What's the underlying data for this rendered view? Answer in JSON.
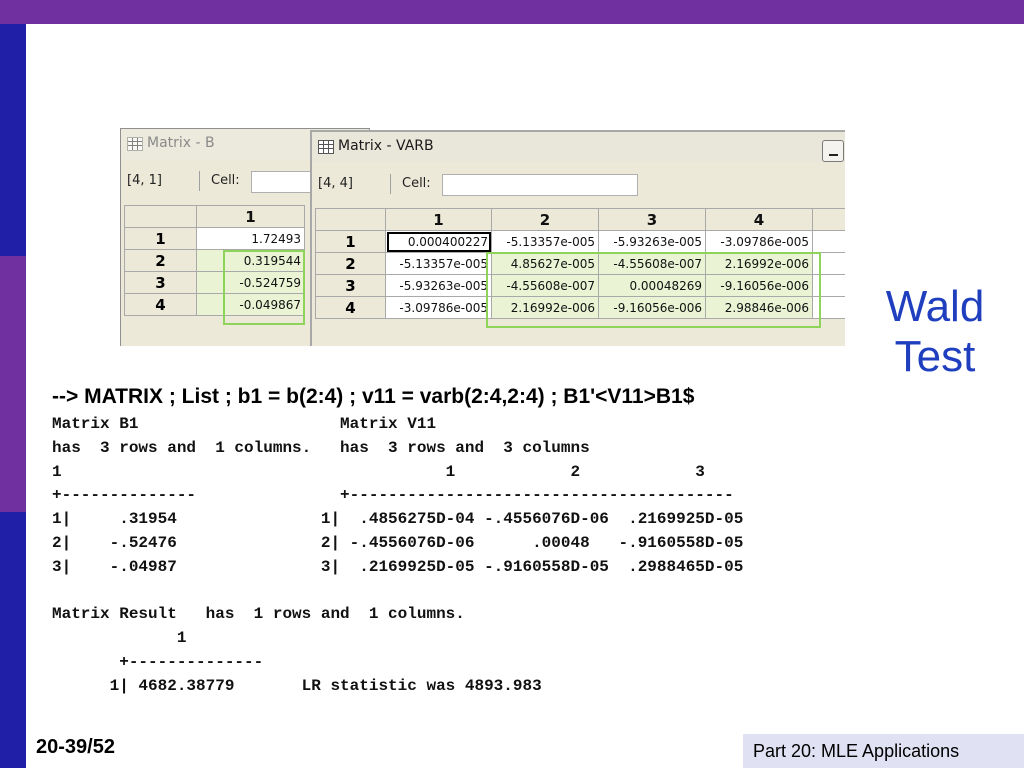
{
  "slide": {
    "side_title_line1": "Wald",
    "side_title_line2": "Test",
    "command": "--> MATRIX ; List ; b1 = b(2:4) ; v11 = varb(2:4,2:4) ; B1'<V11>B1$",
    "page_number": "20-39/52",
    "footer": "Part 20: MLE Applications",
    "colors": {
      "top_bar": "#7030a0",
      "side_bar_blue": "#1f1fa8",
      "side_bar_purple": "#7030a0",
      "title_blue": "#1f3fbf",
      "footer_bg": "#e1e1f4"
    }
  },
  "window_b": {
    "title": "Matrix - B",
    "dims": "[4, 1]",
    "cell_label": "Cell:",
    "col_headers": [
      "1"
    ],
    "rows": [
      {
        "label": "1",
        "values": [
          "1.72493"
        ]
      },
      {
        "label": "2",
        "values": [
          "0.319544"
        ]
      },
      {
        "label": "3",
        "values": [
          "-0.524759"
        ]
      },
      {
        "label": "4",
        "values": [
          "-0.049867"
        ]
      }
    ]
  },
  "window_varb": {
    "title": "Matrix - VARB",
    "dims": "[4, 4]",
    "cell_label": "Cell:",
    "col_headers": [
      "1",
      "2",
      "3",
      "4"
    ],
    "rows": [
      {
        "label": "1",
        "values": [
          "0.000400227",
          "-5.13357e-005",
          "-5.93263e-005",
          "-3.09786e-005"
        ]
      },
      {
        "label": "2",
        "values": [
          "-5.13357e-005",
          "4.85627e-005",
          "-4.55608e-007",
          "2.16992e-006"
        ]
      },
      {
        "label": "3",
        "values": [
          "-5.93263e-005",
          "-4.55608e-007",
          "0.00048269",
          "-9.16056e-006"
        ]
      },
      {
        "label": "4",
        "values": [
          "-3.09786e-005",
          "2.16992e-006",
          "-9.16056e-006",
          "2.98846e-006"
        ]
      }
    ]
  },
  "output": {
    "lines": [
      "Matrix B1                     Matrix V11",
      "has  3 rows and  1 columns.   has  3 rows and  3 columns",
      "1                                        1            2            3",
      "+--------------               +----------------------------------------",
      "1|     .31954               1|  .4856275D-04 -.4556076D-06  .2169925D-05",
      "2|    -.52476               2| -.4556076D-06      .00048   -.9160558D-05",
      "3|    -.04987               3|  .2169925D-05 -.9160558D-05  .2988465D-05",
      "",
      "Matrix Result   has  1 rows and  1 columns.",
      "             1",
      "       +--------------",
      "      1| 4682.38779       LR statistic was 4893.983"
    ]
  }
}
